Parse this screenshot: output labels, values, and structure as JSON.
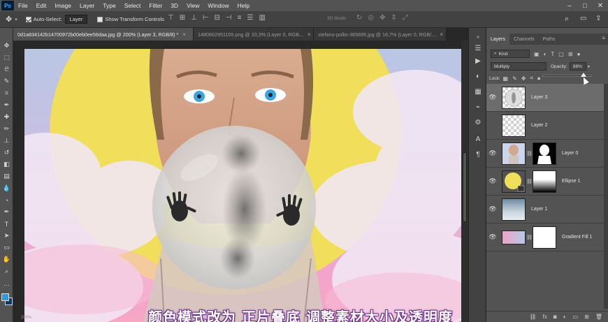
{
  "menubar": {
    "logo": "Ps",
    "items": [
      "File",
      "Edit",
      "Image",
      "Layer",
      "Type",
      "Select",
      "Filter",
      "3D",
      "View",
      "Window",
      "Help"
    ],
    "window_controls": [
      "–",
      "□",
      "✕"
    ]
  },
  "options": {
    "auto_select_label": "Auto-Select:",
    "auto_select_value": "Layer",
    "show_transform_label": "Show Transform Controls",
    "mode_3d_label": "3D Mode:"
  },
  "document_tabs": [
    {
      "label": "0d1a834142b14700972b00eb0ee56daa.jpg @ 200% (Layer 3, RGB/8) *",
      "active": true
    },
    {
      "label": "1480662951109.png @ 33,3% (Layer 0, RGB...",
      "active": false
    },
    {
      "label": "stefano-pollio-365695.jpg @ 16,7% (Layer 0, RGB/...",
      "active": false
    }
  ],
  "status": {
    "zoom": "200%"
  },
  "subtitle": "颜色模式改为 正片叠底 调整素材大小及透明度",
  "layers_panel": {
    "tabs": [
      "Layers",
      "Channels",
      "Paths"
    ],
    "kind_label": "Kind",
    "blend_mode": "Multiply",
    "opacity_label": "Opacity:",
    "opacity_value": "88%",
    "lock_label": "Lock:",
    "layers": [
      {
        "name": "Layer 3",
        "selected": true,
        "thumb": "bubble"
      },
      {
        "name": "Layer 2",
        "selected": false,
        "thumb": "empty"
      },
      {
        "name": "Layer 0",
        "selected": false,
        "thumb": "portrait",
        "mask": true
      },
      {
        "name": "Ellipse 1",
        "selected": false,
        "thumb": "ellipse",
        "mask": true
      },
      {
        "name": "Layer 1",
        "selected": false,
        "thumb": "sky"
      },
      {
        "name": "Gradient Fill 1",
        "selected": false,
        "thumb": "gradient",
        "mask": true
      }
    ]
  },
  "colors": {
    "foreground": "#2f9bd7",
    "background": "#0a3a6a",
    "ellipse": "#f1de5a",
    "sky_gradient_top": "#b9c6e4",
    "sky_gradient_bottom": "#f6a7c4"
  }
}
